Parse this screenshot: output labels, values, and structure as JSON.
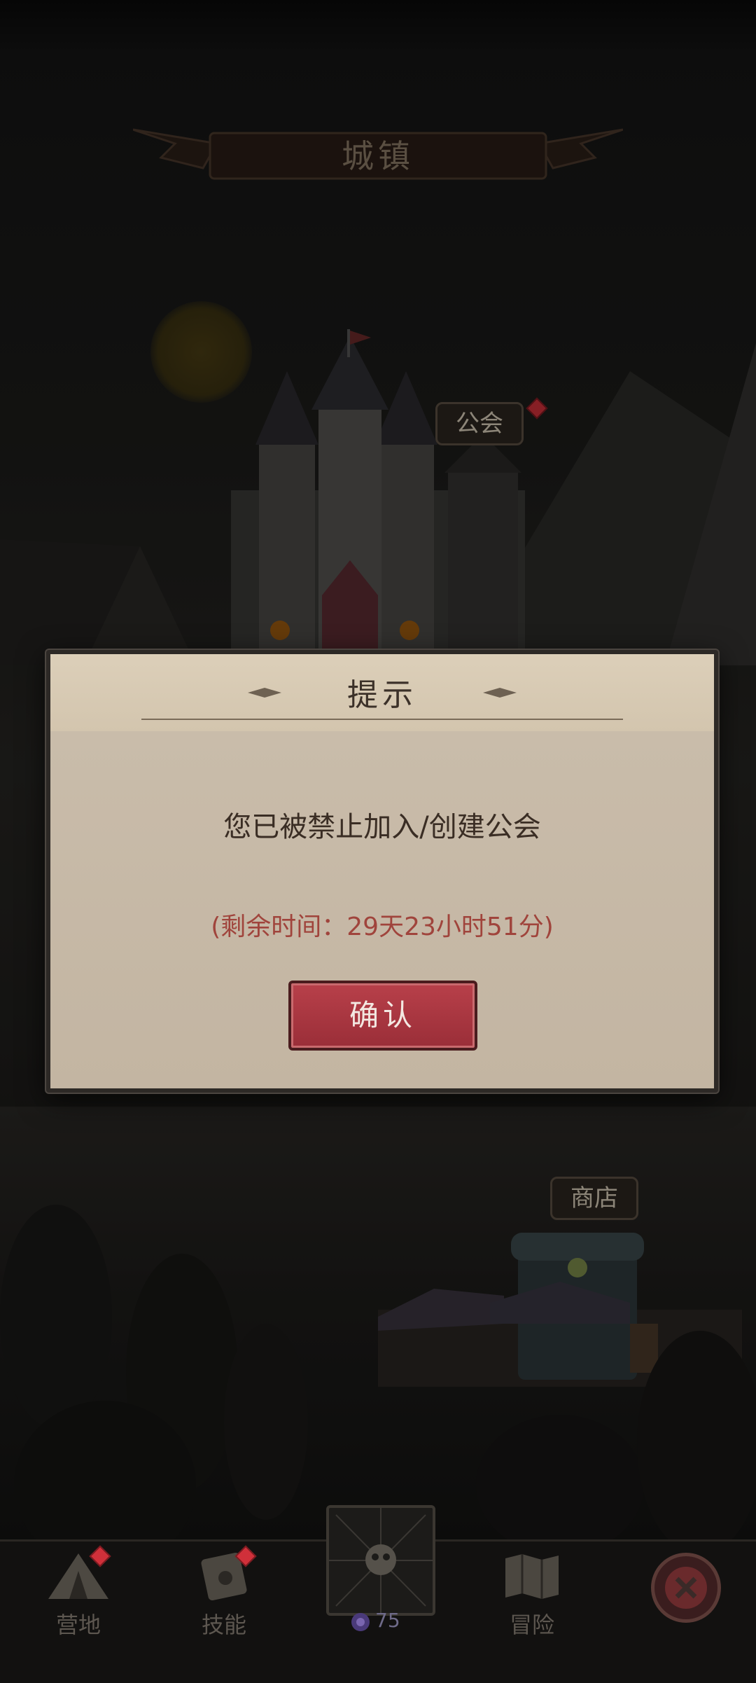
{
  "header": {
    "title": "城镇"
  },
  "map": {
    "guild_label": "公会",
    "shop_label": "商店"
  },
  "dialog": {
    "title": "提示",
    "message": "您已被禁止加入/创建公会",
    "remaining": "(剩余时间：29天23小时51分)",
    "confirm_label": "确认"
  },
  "nav": {
    "items": [
      {
        "label": "营地",
        "icon": "tent-icon",
        "has_notice": true
      },
      {
        "label": "技能",
        "icon": "skill-scroll-icon",
        "has_notice": true
      },
      {
        "label": "冒险",
        "icon": "map-icon",
        "has_notice": false
      }
    ],
    "center": {
      "icon": "skull-spider-icon",
      "energy_value": "75"
    },
    "close_icon": "close-icon"
  },
  "colors": {
    "dialog_bg": "#cfc3b0",
    "confirm_button": "#a8363f",
    "remaining_text": "#a0443c",
    "notice_dot": "#d0303a"
  }
}
